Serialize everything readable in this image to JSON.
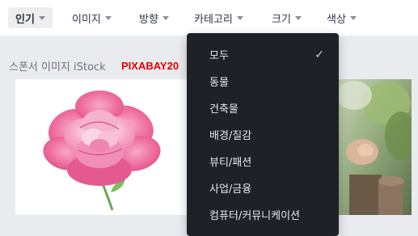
{
  "filters": [
    {
      "label": "인기",
      "active": true
    },
    {
      "label": "이미지",
      "active": false
    },
    {
      "label": "방향",
      "active": false
    },
    {
      "label": "카테고리",
      "active": false
    },
    {
      "label": "크기",
      "active": false
    },
    {
      "label": "색상",
      "active": false
    }
  ],
  "sponsor": {
    "label": "스폰서 이미지 iStock",
    "promo_code": "PIXABAY20"
  },
  "category_menu": {
    "selected": "모두",
    "check_icon": "✓",
    "items": [
      "모두",
      "동물",
      "건축물",
      "배경/질감",
      "뷰티/패션",
      "사업/금융",
      "컴퓨터/커뮤니케이션"
    ]
  },
  "colors": {
    "dropdown_bg": "#1e2128",
    "promo": "#e00000",
    "content_bg": "#e9ebee",
    "active_chip_bg": "#eeeeee"
  }
}
